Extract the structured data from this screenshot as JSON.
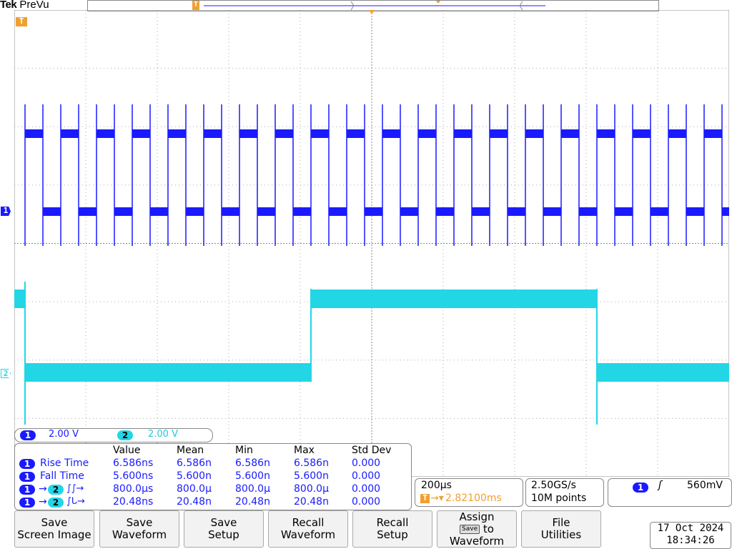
{
  "brand": {
    "maker": "Tek",
    "mode": "PreVu"
  },
  "colors": {
    "ch1": "#1a1aff",
    "ch2": "#22d6e6",
    "trigger": "#f0a030",
    "grid": "#999999"
  },
  "channels": {
    "ch1_label": "1",
    "ch2_label": "2",
    "trigger_label": "T"
  },
  "scale": {
    "ch1_num": "1",
    "ch1_value": "2.00 V",
    "ch2_num": "2",
    "ch2_value": "2.00 V"
  },
  "measurements": {
    "headers": [
      "",
      "Value",
      "Mean",
      "Min",
      "Max",
      "Std Dev"
    ],
    "rows": [
      {
        "ch": "1",
        "name": "Rise Time",
        "value": "6.586ns",
        "mean": "6.586n",
        "min": "6.586n",
        "max": "6.586n",
        "std": "0.000"
      },
      {
        "ch": "1",
        "name": "Fall Time",
        "value": "5.600ns",
        "mean": "5.600n",
        "min": "5.600n",
        "max": "5.600n",
        "std": "0.000"
      },
      {
        "ch": "1",
        "to": "2",
        "name": "→ 2 ∠rise-rise",
        "value": "800.0µs",
        "mean": "800.0µ",
        "min": "800.0µ",
        "max": "800.0µ",
        "std": "0.000"
      },
      {
        "ch": "1",
        "to": "2",
        "name": "→ 2 ∠rise-fall",
        "value": "20.48ns",
        "mean": "20.48n",
        "min": "20.48n",
        "max": "20.48n",
        "std": "0.000"
      }
    ]
  },
  "horizontal": {
    "scale": "200µs",
    "position": "2.82100ms"
  },
  "acquisition": {
    "rate": "2.50GS/s",
    "length": "10M points"
  },
  "trigger": {
    "source": "1",
    "slope": "rising",
    "level": "560mV"
  },
  "buttons": [
    {
      "line1": "Save",
      "line2": "Screen Image"
    },
    {
      "line1": "Save",
      "line2": "Waveform"
    },
    {
      "line1": "Save",
      "line2": "Setup"
    },
    {
      "line1": "Recall",
      "line2": "Waveform"
    },
    {
      "line1": "Recall",
      "line2": "Setup"
    },
    {
      "line1": "Assign",
      "line2": "to",
      "line3": "Waveform",
      "chip": "Save"
    },
    {
      "line1": "File",
      "line2": "Utilities"
    }
  ],
  "datetime": {
    "date": "17 Oct  2024",
    "time": "18:34:26"
  }
}
